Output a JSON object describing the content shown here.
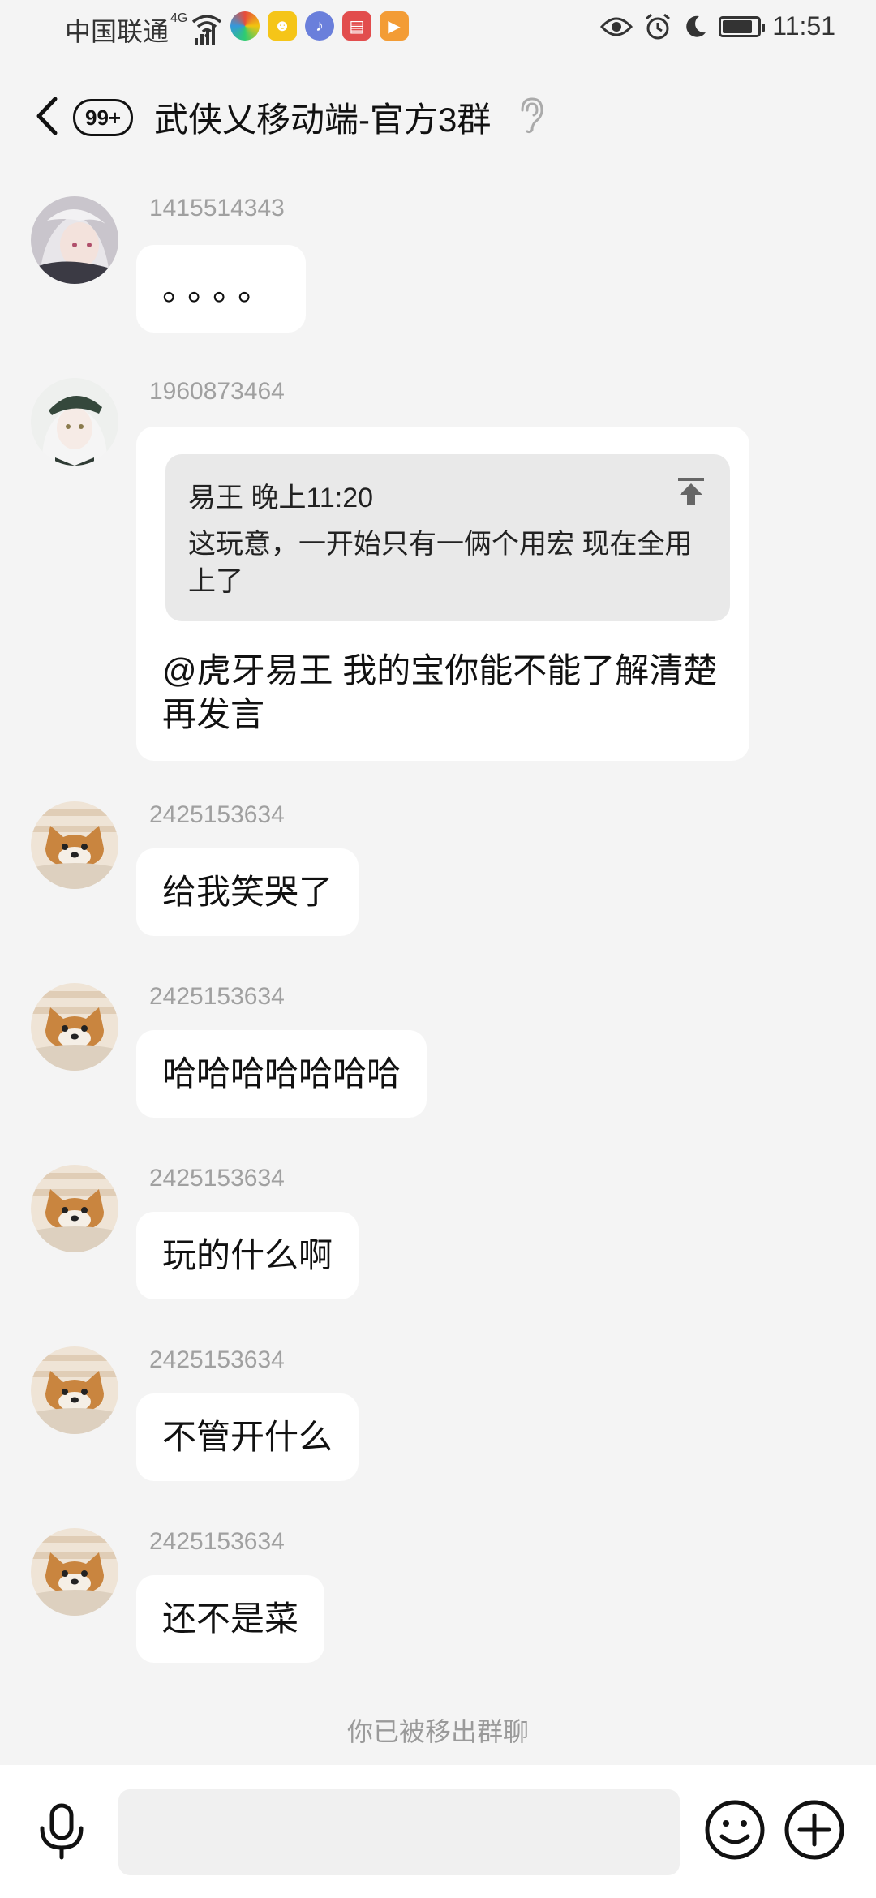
{
  "status_bar": {
    "carrier": "中国联通",
    "network": "4G",
    "time": "11:51",
    "battery_level": 0.85
  },
  "header": {
    "unread_badge": "99+",
    "title": "武侠乂移动端-官方3群"
  },
  "messages": [
    {
      "sender": "1415514343",
      "text": "。。。。",
      "avatar": "anime-girl-avatar"
    },
    {
      "sender": "1960873464",
      "avatar": "anime-girl-cap-avatar",
      "quote": {
        "author": "易王",
        "time": "晚上11:20",
        "text": "这玩意，一开始只有一俩个用宏 现在全用上了"
      },
      "text": "@虎牙易王 我的宝你能不能了解清楚再发言"
    },
    {
      "sender": "2425153634",
      "text": "给我笑哭了",
      "avatar": "shiba-dog-avatar"
    },
    {
      "sender": "2425153634",
      "text": "哈哈哈哈哈哈哈",
      "avatar": "shiba-dog-avatar"
    },
    {
      "sender": "2425153634",
      "text": "玩的什么啊",
      "avatar": "shiba-dog-avatar"
    },
    {
      "sender": "2425153634",
      "text": "不管开什么",
      "avatar": "shiba-dog-avatar"
    },
    {
      "sender": "2425153634",
      "text": "还不是菜",
      "avatar": "shiba-dog-avatar"
    }
  ],
  "system_note": "你已被移出群聊",
  "input": {
    "placeholder": ""
  },
  "icons": {
    "back": "chevron-left-icon",
    "ear": "ear-icon",
    "pin": "pin-to-top-icon",
    "mic": "microphone-icon",
    "emoji": "emoji-icon",
    "plus": "plus-icon"
  }
}
